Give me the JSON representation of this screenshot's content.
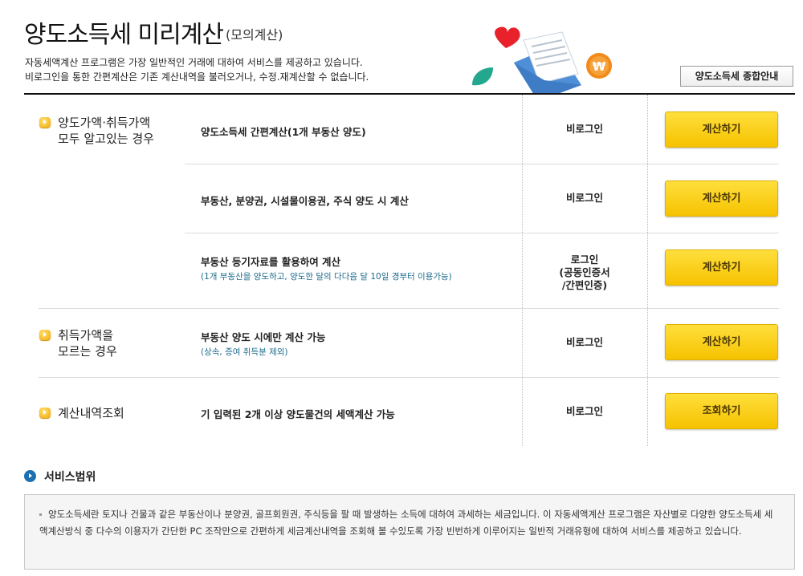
{
  "header": {
    "title": "양도소득세 미리계산",
    "subtitle": "(모의계산)",
    "intro_line1": "자동세액계산 프로그램은 가장 일반적인 거래에 대하여 서비스를 제공하고 있습니다.",
    "intro_line2": "비로그인을 통한 간편계산은 기존 계산내역을 불러오거나, 수정.재계산할 수 없습니다.",
    "guide_button": "양도소득세 종합안내"
  },
  "categories": [
    {
      "line1": "양도가액·취득가액",
      "line2": "모두 알고있는 경우"
    },
    {
      "line1": "취득가액을",
      "line2": "모르는 경우"
    },
    {
      "line1": "계산내역조회",
      "line2": ""
    }
  ],
  "rows": [
    {
      "desc": "양도소득세 간편계산(1개 부동산 양도)",
      "sub": "",
      "req": [
        "비로그인"
      ],
      "button": "계산하기"
    },
    {
      "desc": "부동산, 분양권, 시설물이용권, 주식 양도 시 계산",
      "sub": "",
      "req": [
        "비로그인"
      ],
      "button": "계산하기"
    },
    {
      "desc": "부동산 등기자료를 활용하여 계산",
      "sub": "(1개 부동산을 양도하고, 양도한 달의 다다음 달 10일 경부터 이용가능)",
      "req": [
        "로그인",
        "(공동인증서",
        "/간편인증)"
      ],
      "button": "계산하기"
    },
    {
      "desc": "부동산 양도 시에만 계산 가능",
      "sub": "(상속, 증여 취득분 제외)",
      "req": [
        "비로그인"
      ],
      "button": "계산하기"
    },
    {
      "desc": "기 입력된 2개 이상 양도물건의 세액계산 가능",
      "sub": "",
      "req": [
        "비로그인"
      ],
      "button": "조회하기"
    }
  ],
  "service": {
    "title": "서비스범위",
    "text": "양도소득세란 토지나 건물과 같은 부동산이나 분양권, 골프회원권, 주식등을 팔 때 발생하는 소득에 대하여 과세하는 세금입니다. 이 자동세액계산 프로그램은 자산별로 다양한 양도소득세 세액계산방식 중 다수의 이용자가 간단한 PC 조작만으로 간편하게 세금계산내역을 조회해 볼 수있도록 가장 빈번하게 이루어지는 일반적 거래유형에 대하여 서비스를 제공하고 있습니다."
  },
  "illustration": {
    "coin_symbol": "₩",
    "colors": {
      "heart": "#e8212b",
      "coin": "#f28a1a",
      "envelope": "#4f8fd8",
      "leaf": "#23a88f"
    }
  },
  "colors": {
    "button": "#f6c200",
    "accent": "#1e6fb0",
    "sub_text": "#1d6b8c"
  }
}
